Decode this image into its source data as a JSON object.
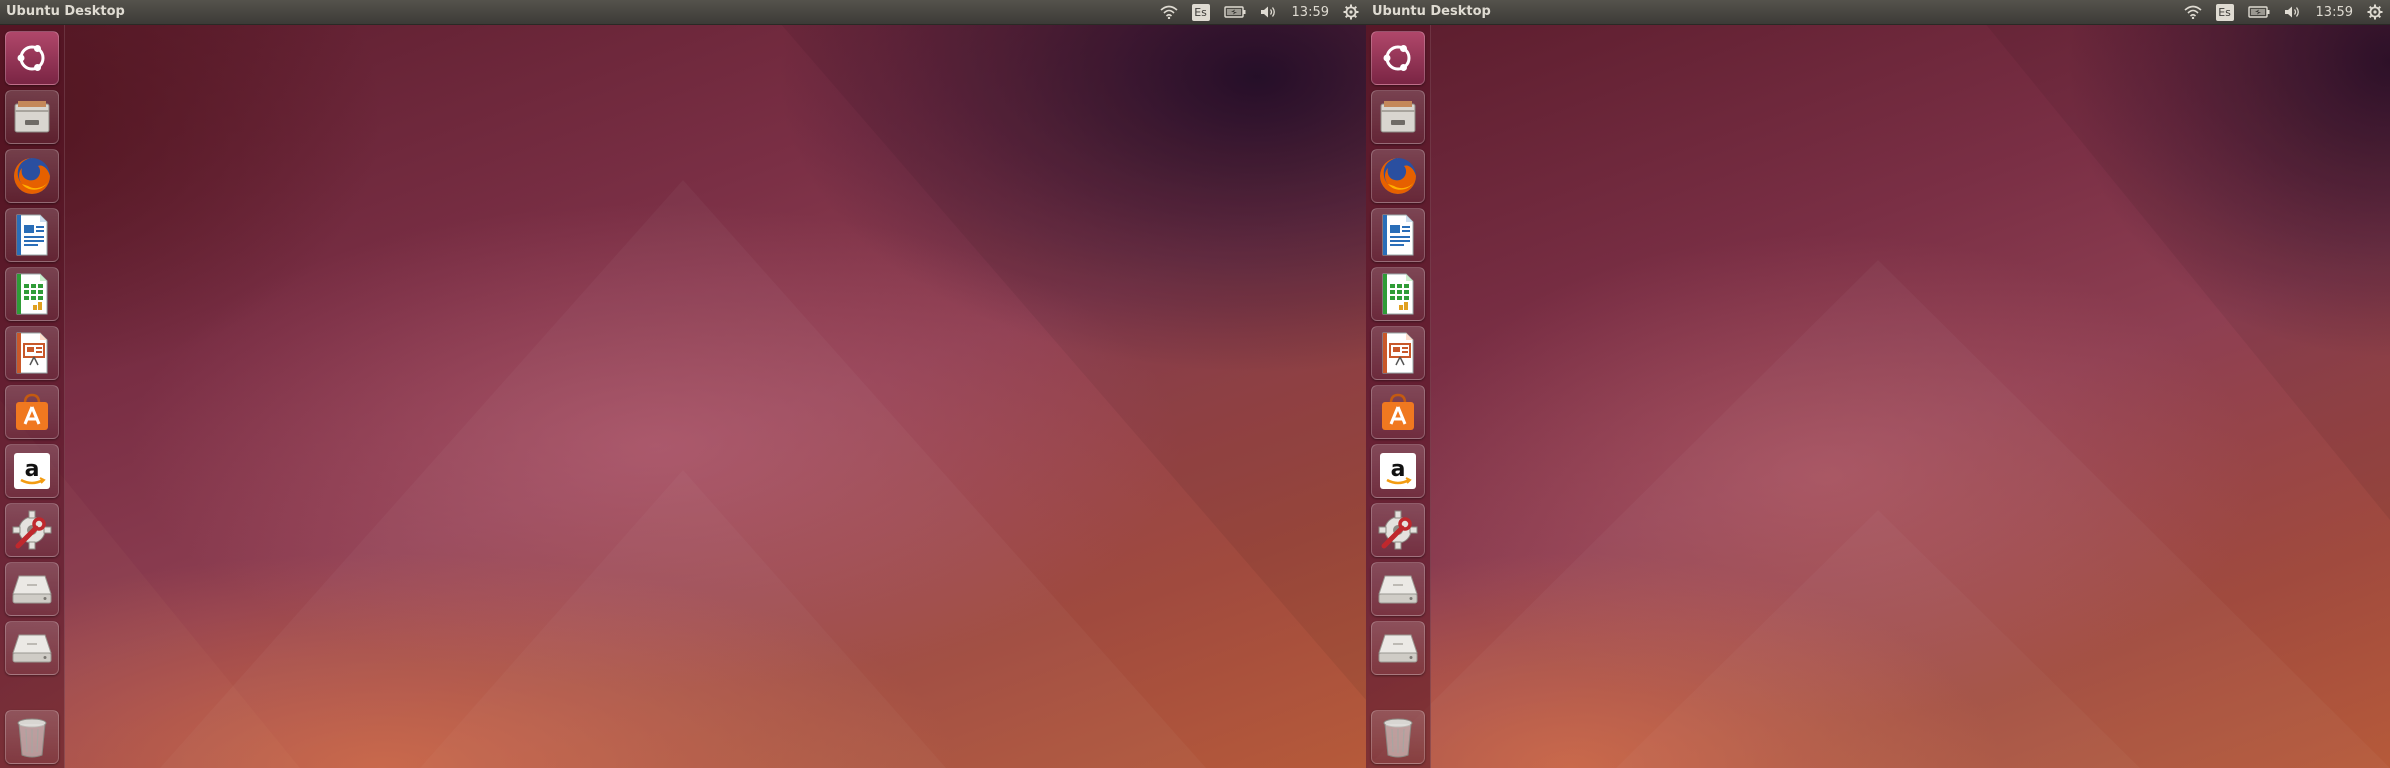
{
  "screens": [
    {
      "panel": {
        "title": "Ubuntu Desktop",
        "keyboard_layout": "Es",
        "clock": "13:59"
      },
      "launcher": {
        "items": [
          {
            "name": "Search your computer",
            "icon": "ubuntu-dash-icon"
          },
          {
            "name": "Files",
            "icon": "files-icon"
          },
          {
            "name": "Firefox Web Browser",
            "icon": "firefox-icon"
          },
          {
            "name": "LibreOffice Writer",
            "icon": "writer-icon"
          },
          {
            "name": "LibreOffice Calc",
            "icon": "calc-icon"
          },
          {
            "name": "LibreOffice Impress",
            "icon": "impress-icon"
          },
          {
            "name": "Ubuntu Software Center",
            "icon": "software-center-icon"
          },
          {
            "name": "Amazon",
            "icon": "amazon-icon"
          },
          {
            "name": "System Settings",
            "icon": "settings-icon"
          },
          {
            "name": "Drive",
            "icon": "drive-icon"
          },
          {
            "name": "Drive",
            "icon": "drive-icon"
          },
          {
            "name": "Trash",
            "icon": "trash-icon"
          }
        ]
      }
    },
    {
      "panel": {
        "title": "Ubuntu Desktop",
        "keyboard_layout": "Es",
        "clock": "13:59"
      },
      "launcher": {
        "items": [
          {
            "name": "Search your computer",
            "icon": "ubuntu-dash-icon"
          },
          {
            "name": "Files",
            "icon": "files-icon"
          },
          {
            "name": "Firefox Web Browser",
            "icon": "firefox-icon"
          },
          {
            "name": "LibreOffice Writer",
            "icon": "writer-icon"
          },
          {
            "name": "LibreOffice Calc",
            "icon": "calc-icon"
          },
          {
            "name": "LibreOffice Impress",
            "icon": "impress-icon"
          },
          {
            "name": "Ubuntu Software Center",
            "icon": "software-center-icon"
          },
          {
            "name": "Amazon",
            "icon": "amazon-icon"
          },
          {
            "name": "System Settings",
            "icon": "settings-icon"
          },
          {
            "name": "Drive",
            "icon": "drive-icon"
          },
          {
            "name": "Drive",
            "icon": "drive-icon"
          },
          {
            "name": "Trash",
            "icon": "trash-icon"
          }
        ]
      }
    }
  ],
  "colors": {
    "panel_background": "#3c3b37",
    "panel_text": "#dfdbd2",
    "launcher_tint": "#561424",
    "wallpaper_base": "#7a2f45",
    "wallpaper_accent": "#b65a3a"
  }
}
